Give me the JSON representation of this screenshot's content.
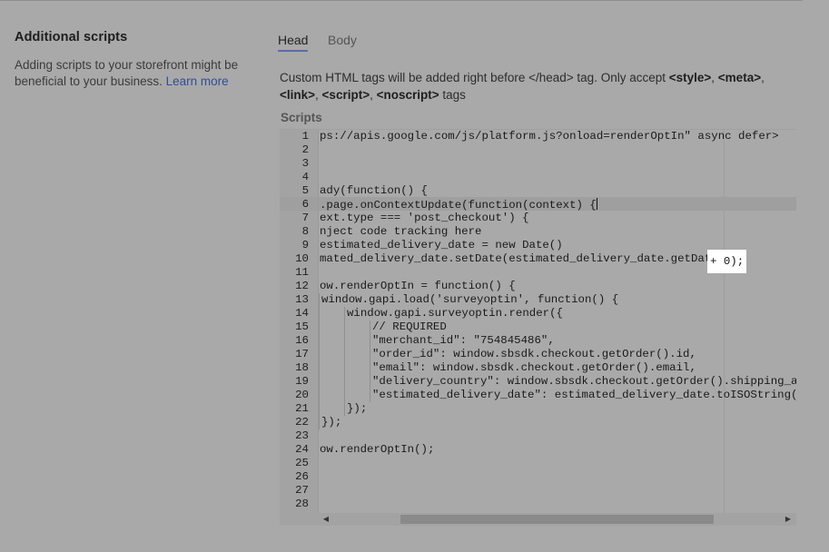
{
  "section": {
    "title": "Additional scripts",
    "description": "Adding scripts to your storefront might be beneficial to your business.",
    "learn_more": "Learn more"
  },
  "tabs": [
    {
      "label": "Head",
      "active": true
    },
    {
      "label": "Body",
      "active": false
    }
  ],
  "help": {
    "prefix": "Custom HTML tags will be added right before </head> tag. Only accept ",
    "tag_style": "<style>",
    "tag_meta": "<meta>",
    "tag_link": "<link>",
    "tag_script": "<script>",
    "tag_noscript": "<noscript>",
    "sep": ", ",
    "suffix": " tags"
  },
  "scripts_label": "Scripts",
  "editor": {
    "lines": [
      {
        "n": "1",
        "text": "ps://apis.google.com/js/platform.js?onload=renderOptIn\" async defer>"
      },
      {
        "n": "2",
        "text": ""
      },
      {
        "n": "3",
        "text": ""
      },
      {
        "n": "4",
        "text": ""
      },
      {
        "n": "5",
        "text": "ady(function() {"
      },
      {
        "n": "6",
        "text": ".page.onContextUpdate(function(context) {"
      },
      {
        "n": "7",
        "text": "ext.type === 'post_checkout') {"
      },
      {
        "n": "8",
        "text": "nject code tracking here"
      },
      {
        "n": "9",
        "text": "estimated_delivery_date = new Date()"
      },
      {
        "n": "10",
        "text": "mated_delivery_date.setDate(estimated_delivery_date.getDate()"
      },
      {
        "n": "11",
        "text": ""
      },
      {
        "n": "12",
        "text": "ow.renderOptIn = function() {"
      },
      {
        "n": "13",
        "text": "window.gapi.load('surveyoptin', function() {"
      },
      {
        "n": "14",
        "text": "window.gapi.surveyoptin.render({"
      },
      {
        "n": "15",
        "text": "// REQUIRED"
      },
      {
        "n": "16",
        "text": "\"merchant_id\": \"754845486\","
      },
      {
        "n": "17",
        "text": "\"order_id\": window.sbsdk.checkout.getOrder().id,"
      },
      {
        "n": "18",
        "text": "\"email\": window.sbsdk.checkout.getOrder().email,"
      },
      {
        "n": "19",
        "text": "\"delivery_country\": window.sbsdk.checkout.getOrder().shipping_addre"
      },
      {
        "n": "20",
        "text": "\"estimated_delivery_date\": estimated_delivery_date.toISOString().sp"
      },
      {
        "n": "21",
        "text": "});"
      },
      {
        "n": "22",
        "text": "});"
      },
      {
        "n": "23",
        "text": ""
      },
      {
        "n": "24",
        "text": "ow.renderOptIn();"
      },
      {
        "n": "25",
        "text": ""
      },
      {
        "n": "26",
        "text": ""
      },
      {
        "n": "27",
        "text": ""
      },
      {
        "n": "28",
        "text": ""
      }
    ],
    "highlight_text": "+ 0);"
  }
}
